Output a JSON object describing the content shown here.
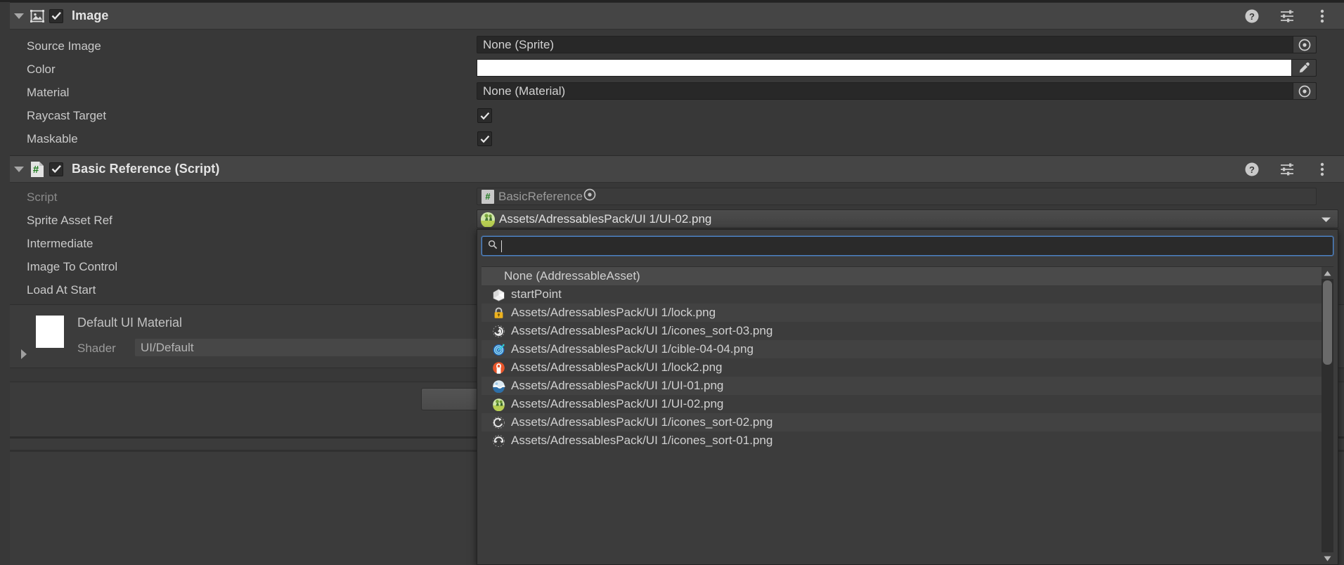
{
  "image_component": {
    "title": "Image",
    "enabled": true,
    "expanded": true,
    "icon": "image-component-icon",
    "header_buttons": [
      "help-icon",
      "preset-icon",
      "more-menu-icon"
    ],
    "properties": [
      {
        "label": "Source Image",
        "type": "object",
        "value": "None (Sprite)",
        "picker": "object-picker-icon"
      },
      {
        "label": "Color",
        "type": "color",
        "value": "#FFFFFF",
        "picker": "eyedropper-icon"
      },
      {
        "label": "Material",
        "type": "object",
        "value": "None (Material)",
        "picker": "object-picker-icon"
      },
      {
        "label": "Raycast Target",
        "type": "bool",
        "value": true
      },
      {
        "label": "Maskable",
        "type": "bool",
        "value": true
      }
    ]
  },
  "script_component": {
    "title": "Basic Reference (Script)",
    "enabled": true,
    "expanded": true,
    "icon": "csharp-script-icon",
    "header_buttons": [
      "help-icon",
      "preset-icon",
      "more-menu-icon"
    ],
    "properties": [
      {
        "label": "Script",
        "value": "BasicReference",
        "readonly": true
      },
      {
        "label": "Sprite Asset Ref",
        "value": "Assets/AdressablesPack/UI 1/UI-02.png"
      },
      {
        "label": "Intermediate",
        "value": ""
      },
      {
        "label": "Image To Control",
        "value": ""
      },
      {
        "label": "Load At Start",
        "value": ""
      }
    ]
  },
  "material_preview": {
    "name": "Default UI Material",
    "shader_label": "Shader",
    "shader_value": "UI/Default",
    "swatch_color": "#FFFFFF"
  },
  "dropdown": {
    "open": true,
    "search": {
      "value": "",
      "placeholder": "",
      "icon": "search-icon"
    },
    "items": [
      {
        "label": "None (AddressableAsset)",
        "icon": "none-icon",
        "selected": true
      },
      {
        "label": "startPoint",
        "icon": "unity-prefab-icon"
      },
      {
        "label": "Assets/AdressablesPack/UI 1/lock.png",
        "icon": "lock-yellow-icon"
      },
      {
        "label": "Assets/AdressablesPack/UI 1/icones_sort-03.png",
        "icon": "spiral-icon"
      },
      {
        "label": "Assets/AdressablesPack/UI 1/cible-04-04.png",
        "icon": "target-blue-icon"
      },
      {
        "label": "Assets/AdressablesPack/UI 1/lock2.png",
        "icon": "lock-orange-icon"
      },
      {
        "label": "Assets/AdressablesPack/UI 1/UI-01.png",
        "icon": "ui01-icon"
      },
      {
        "label": "Assets/AdressablesPack/UI 1/UI-02.png",
        "icon": "ui02-icon"
      },
      {
        "label": "Assets/AdressablesPack/UI 1/icones_sort-02.png",
        "icon": "sort02-icon"
      },
      {
        "label": "Assets/AdressablesPack/UI 1/icones_sort-01.png",
        "icon": "sort01-icon"
      }
    ],
    "scrollbar": {
      "up": "scroll-up-arrow",
      "down": "scroll-down-arrow"
    }
  },
  "colors": {
    "accent_blue": "#4D84C8",
    "panel_bg": "#383838",
    "header_bg": "#454545",
    "field_bg": "#282828"
  }
}
